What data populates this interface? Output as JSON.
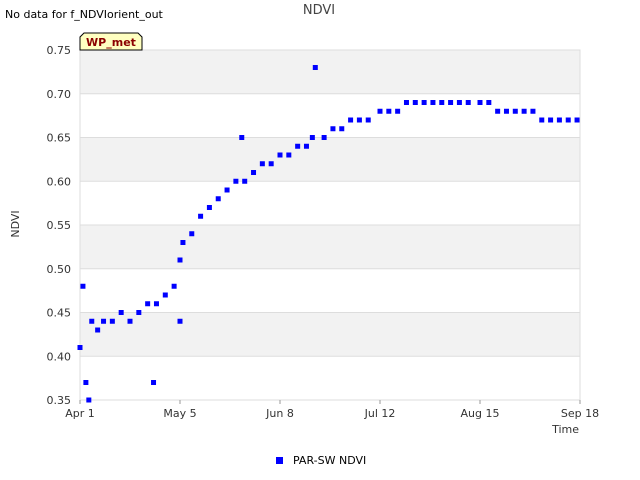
{
  "notice": "No data for f_NDVIorient_out",
  "badge": {
    "label": "WP_met",
    "fill": "#ffffc0",
    "text_color": "#8b0000"
  },
  "colors": {
    "band": "#f2f2f2",
    "grid": "#dddddd",
    "series": "#0000ff"
  },
  "chart_data": {
    "type": "scatter",
    "title": "NDVI",
    "xlabel": "Time",
    "ylabel": "NDVI",
    "x_range": [
      "Apr 1",
      "Sep 18"
    ],
    "ylim": [
      0.35,
      0.75
    ],
    "y_ticks": [
      "0.35",
      "0.40",
      "0.45",
      "0.50",
      "0.55",
      "0.60",
      "0.65",
      "0.70",
      "0.75"
    ],
    "x_ticks": [
      "Apr 1",
      "May 5",
      "Jun 8",
      "Jul 12",
      "Aug 15",
      "Sep 18"
    ],
    "grid": true,
    "legend_position": "bottom",
    "series": [
      {
        "name": "PAR-SW NDVI",
        "color": "#0000ff",
        "points": [
          [
            "Apr 1",
            0.41
          ],
          [
            "Apr 2",
            0.48
          ],
          [
            "Apr 3",
            0.37
          ],
          [
            "Apr 4",
            0.35
          ],
          [
            "Apr 5",
            0.44
          ],
          [
            "Apr 7",
            0.43
          ],
          [
            "Apr 9",
            0.44
          ],
          [
            "Apr 12",
            0.44
          ],
          [
            "Apr 15",
            0.45
          ],
          [
            "Apr 18",
            0.44
          ],
          [
            "Apr 21",
            0.45
          ],
          [
            "Apr 24",
            0.46
          ],
          [
            "Apr 26",
            0.37
          ],
          [
            "Apr 27",
            0.46
          ],
          [
            "Apr 30",
            0.47
          ],
          [
            "May 3",
            0.48
          ],
          [
            "May 5",
            0.44
          ],
          [
            "May 5",
            0.51
          ],
          [
            "May 6",
            0.53
          ],
          [
            "May 9",
            0.54
          ],
          [
            "May 12",
            0.56
          ],
          [
            "May 15",
            0.57
          ],
          [
            "May 18",
            0.58
          ],
          [
            "May 21",
            0.59
          ],
          [
            "May 24",
            0.6
          ],
          [
            "May 26",
            0.65
          ],
          [
            "May 27",
            0.6
          ],
          [
            "May 30",
            0.61
          ],
          [
            "Jun 2",
            0.62
          ],
          [
            "Jun 5",
            0.62
          ],
          [
            "Jun 8",
            0.63
          ],
          [
            "Jun 11",
            0.63
          ],
          [
            "Jun 14",
            0.64
          ],
          [
            "Jun 17",
            0.64
          ],
          [
            "Jun 19",
            0.65
          ],
          [
            "Jun 20",
            0.73
          ],
          [
            "Jun 23",
            0.65
          ],
          [
            "Jun 26",
            0.66
          ],
          [
            "Jun 29",
            0.66
          ],
          [
            "Jul 2",
            0.67
          ],
          [
            "Jul 5",
            0.67
          ],
          [
            "Jul 8",
            0.67
          ],
          [
            "Jul 12",
            0.68
          ],
          [
            "Jul 15",
            0.68
          ],
          [
            "Jul 18",
            0.68
          ],
          [
            "Jul 21",
            0.69
          ],
          [
            "Jul 24",
            0.69
          ],
          [
            "Jul 27",
            0.69
          ],
          [
            "Jul 30",
            0.69
          ],
          [
            "Aug 2",
            0.69
          ],
          [
            "Aug 5",
            0.69
          ],
          [
            "Aug 8",
            0.69
          ],
          [
            "Aug 11",
            0.69
          ],
          [
            "Aug 15",
            0.69
          ],
          [
            "Aug 18",
            0.69
          ],
          [
            "Aug 21",
            0.68
          ],
          [
            "Aug 24",
            0.68
          ],
          [
            "Aug 27",
            0.68
          ],
          [
            "Aug 30",
            0.68
          ],
          [
            "Sep 2",
            0.68
          ],
          [
            "Sep 5",
            0.67
          ],
          [
            "Sep 8",
            0.67
          ],
          [
            "Sep 11",
            0.67
          ],
          [
            "Sep 14",
            0.67
          ],
          [
            "Sep 17",
            0.67
          ]
        ]
      }
    ]
  }
}
